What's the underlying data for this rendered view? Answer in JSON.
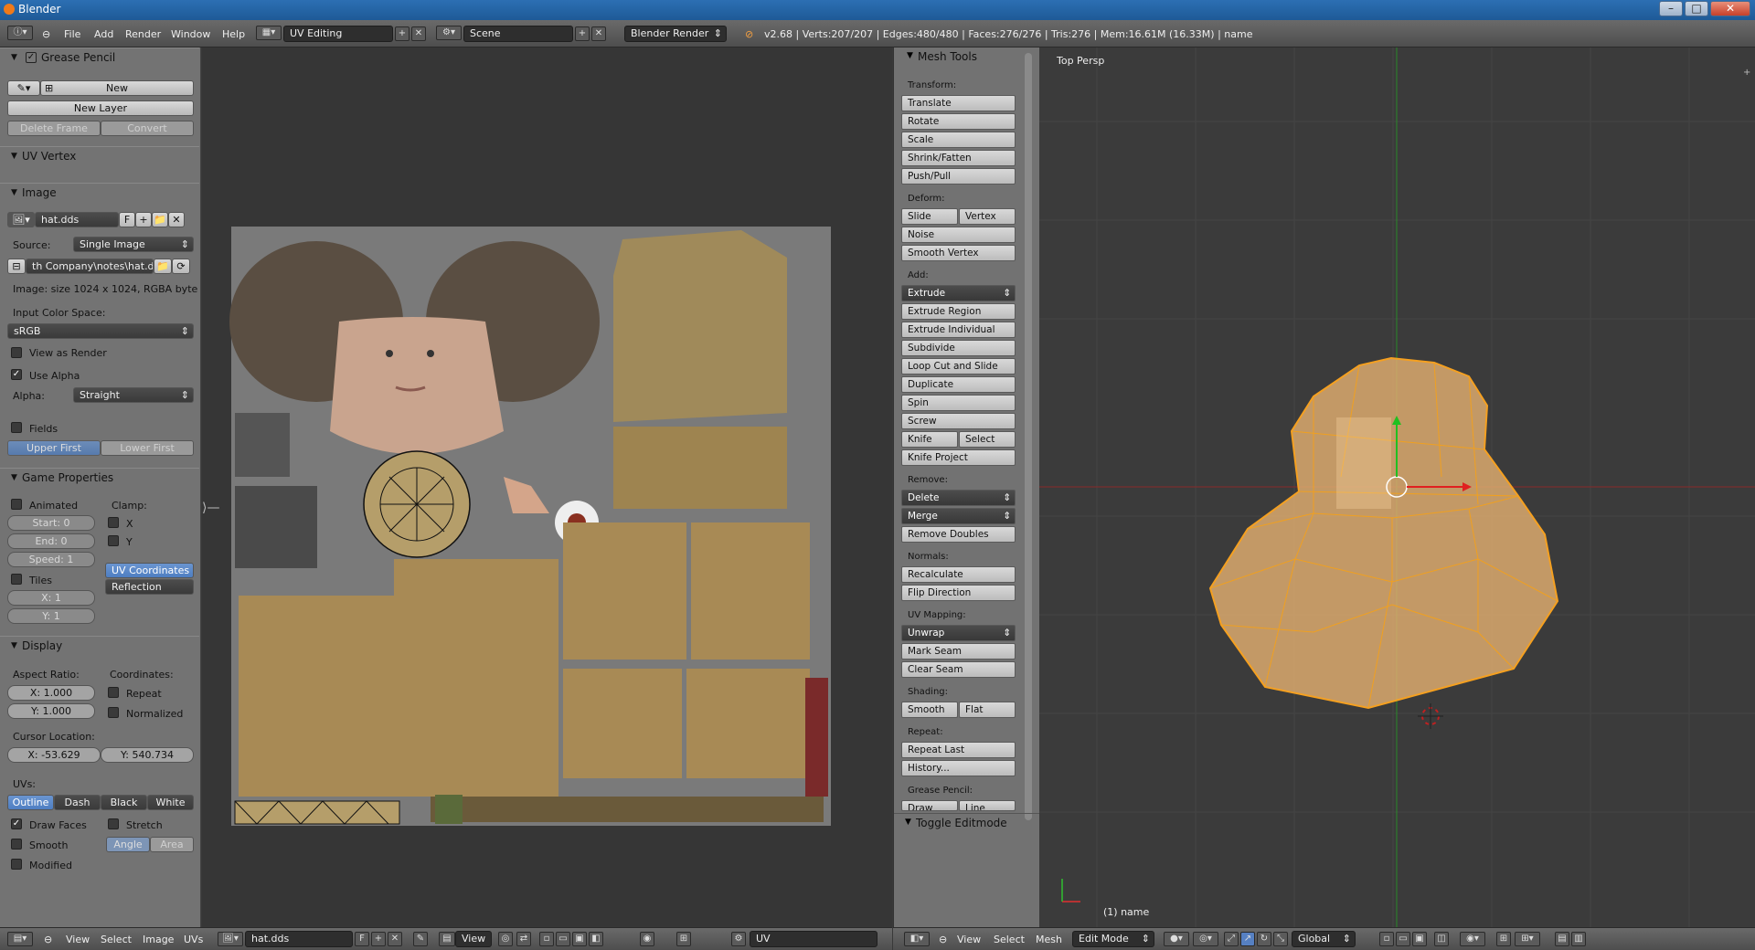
{
  "window": {
    "title": "Blender"
  },
  "topbar": {
    "menus": [
      "File",
      "Add",
      "Render",
      "Window",
      "Help"
    ],
    "layout": "UV Editing",
    "scene": "Scene",
    "engine": "Blender Render",
    "stats": "v2.68 | Verts:207/207 | Edges:480/480 | Faces:276/276 | Tris:276 | Mem:16.61M (16.33M) | name"
  },
  "left": {
    "grease_pencil": {
      "title": "Grease Pencil",
      "new": "New",
      "new_layer": "New Layer",
      "delete_frame": "Delete Frame",
      "convert": "Convert"
    },
    "uv_vertex": {
      "title": "UV Vertex"
    },
    "image": {
      "title": "Image",
      "name": "hat.dds",
      "fake_user": "F",
      "source_label": "Source:",
      "source": "Single Image",
      "path": "th Company\\notes\\hat.dds",
      "info": "Image: size 1024 x 1024, RGBA byte",
      "color_space_label": "Input Color Space:",
      "color_space": "sRGB",
      "view_as_render": "View as Render",
      "use_alpha": "Use Alpha",
      "alpha_label": "Alpha:",
      "alpha": "Straight",
      "fields": "Fields",
      "upper_first": "Upper First",
      "lower_first": "Lower First"
    },
    "game": {
      "title": "Game Properties",
      "animated": "Animated",
      "clamp": "Clamp:",
      "start": "Start: 0",
      "end": "End: 0",
      "speed": "Speed: 1",
      "x": "X",
      "y": "Y",
      "tiles": "Tiles",
      "tx": "X: 1",
      "ty": "Y: 1",
      "uv_coords": "UV Coordinates",
      "reflection": "Reflection"
    },
    "display": {
      "title": "Display",
      "aspect": "Aspect Ratio:",
      "ax": "X: 1.000",
      "ay": "Y: 1.000",
      "coords": "Coordinates:",
      "repeat": "Repeat",
      "normalized": "Normalized",
      "cursor": "Cursor Location:",
      "cx": "X: -53.629",
      "cy": "Y: 540.734",
      "uvs": "UVs:",
      "outline": "Outline",
      "dash": "Dash",
      "black": "Black",
      "white": "White",
      "draw_faces": "Draw Faces",
      "stretch": "Stretch",
      "smooth": "Smooth",
      "angle": "Angle",
      "area": "Area",
      "modified": "Modified"
    }
  },
  "mesh_tools": {
    "title": "Mesh Tools",
    "transform": "Transform:",
    "translate": "Translate",
    "rotate": "Rotate",
    "scale": "Scale",
    "shrink": "Shrink/Fatten",
    "push": "Push/Pull",
    "deform": "Deform:",
    "slide_edge": "Slide Edge",
    "vertex": "Vertex",
    "noise": "Noise",
    "smooth_vertex": "Smooth Vertex",
    "add": "Add:",
    "extrude": "Extrude",
    "extrude_region": "Extrude Region",
    "extrude_individual": "Extrude Individual",
    "subdivide": "Subdivide",
    "loop_cut": "Loop Cut and Slide",
    "duplicate": "Duplicate",
    "spin": "Spin",
    "screw": "Screw",
    "knife": "Knife",
    "select": "Select",
    "knife_project": "Knife Project",
    "remove": "Remove:",
    "delete": "Delete",
    "merge": "Merge",
    "remove_doubles": "Remove Doubles",
    "normals": "Normals:",
    "recalculate": "Recalculate",
    "flip": "Flip Direction",
    "uv_mapping": "UV Mapping:",
    "unwrap": "Unwrap",
    "mark_seam": "Mark Seam",
    "clear_seam": "Clear Seam",
    "shading": "Shading:",
    "smooth": "Smooth",
    "flat": "Flat",
    "repeat": "Repeat:",
    "repeat_last": "Repeat Last",
    "history": "History...",
    "grease_pencil": "Grease Pencil:",
    "draw": "Draw",
    "line": "Line",
    "toggle_editmode": "Toggle Editmode"
  },
  "viewport": {
    "label": "Top Persp",
    "object": "(1) name"
  },
  "bottom": {
    "uv_menus": [
      "View",
      "Select",
      "Image",
      "UVs"
    ],
    "image_name": "hat.dds",
    "fake": "F",
    "view": "View",
    "uv": "UV",
    "vp_menus": [
      "View",
      "Select",
      "Mesh"
    ],
    "mode": "Edit Mode",
    "orientation": "Global"
  }
}
